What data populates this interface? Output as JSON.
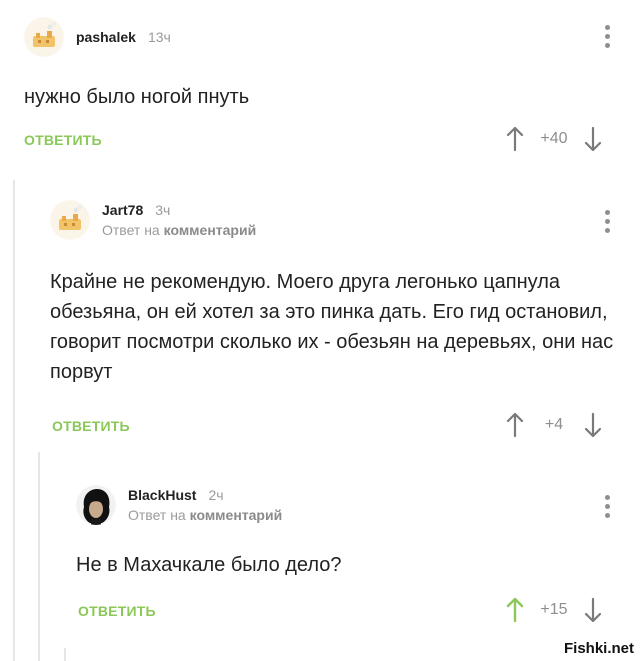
{
  "comments": [
    {
      "author": "pashalek",
      "time": "13ч",
      "text": "нужно было ногой пнуть",
      "reply_label": "ОТВЕТИТЬ",
      "score": "+40"
    },
    {
      "author": "Jart78",
      "time": "3ч",
      "reply_to_prefix": "Ответ на",
      "reply_to_target": "комментарий",
      "text": "Крайне не рекомендую. Моего друга легонько цапнула обезьяна, он ей хотел за это пинка дать. Его гид остановил, говорит посмотри сколько их - обезьян на деревьях, они нас порвут",
      "reply_label": "ОТВЕТИТЬ",
      "score": "+4"
    },
    {
      "author": "BlackHust",
      "time": "2ч",
      "reply_to_prefix": "Ответ на",
      "reply_to_target": "комментарий",
      "text": "Не в Махачкале было дело?",
      "reply_label": "ОТВЕТИТЬ",
      "score": "+15",
      "upvoted": true
    }
  ],
  "colors": {
    "accent_green": "#8ac858",
    "muted_gray": "#9b9b9b",
    "arrow_gray": "#7a7a7a",
    "thread_line": "#e6e6e6"
  },
  "watermark": "Fishki.net"
}
